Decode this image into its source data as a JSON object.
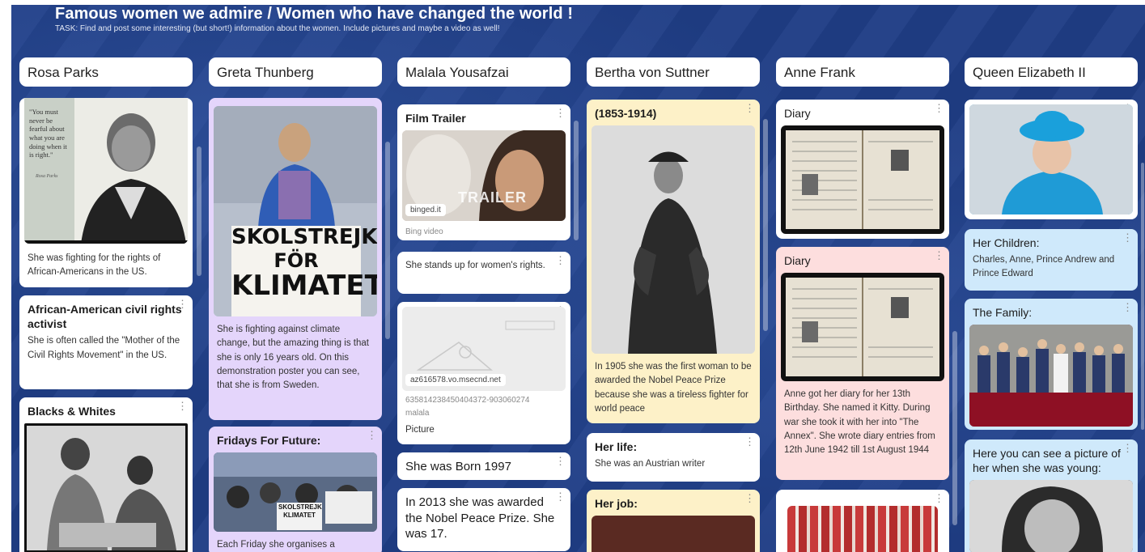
{
  "board": {
    "title": "Famous women we admire / Women who have changed the world !",
    "subtitle": "TASK: Find and post some interesting (but short!) information about the women. Include pictures and maybe a video as well!"
  },
  "columns": [
    {
      "header": "Rosa Parks",
      "posts": [
        {
          "body": "She was fighting for the rights of African-Americans in the US.",
          "quote": "\"You must never be fearful about what you are doing when it is right.\"",
          "quote_attr": "Rosa Parks"
        },
        {
          "title": "African-American civil rights activist",
          "body": "She is often called the \"Mother of the Civil Rights Movement\" in the US."
        },
        {
          "title": "Blacks & Whites"
        }
      ]
    },
    {
      "header": "Greta Thunberg",
      "posts": [
        {
          "sign_line1": "SKOLSTREJK",
          "sign_line2": "FÖR",
          "sign_line3": "KLIMATET",
          "body": "She is fighting against climate change, but the amazing thing is that she is only 16 years old. On this demonstration poster you can see, that she is from Sweden."
        },
        {
          "title": "Fridays For Future:",
          "sign_small1": "SKOLSTREJK",
          "sign_small2": "KLIMATET",
          "body": "Each Friday she organises a"
        }
      ]
    },
    {
      "header": "Malala Yousafzai",
      "posts": [
        {
          "title": "Film Trailer",
          "link": "binged.it",
          "overlay": "TRAILER",
          "meta": "Bing video"
        },
        {
          "body": "She stands up for women's rights."
        },
        {
          "link": "az616578.vo.msecnd.net",
          "meta1": "635814238450404372-903060274",
          "meta2": "malala",
          "label": "Picture"
        },
        {
          "title": "She was Born 1997"
        },
        {
          "title": "In 2013 she was awarded the Nobel Peace Prize. She was 17."
        }
      ]
    },
    {
      "header": "Bertha von Suttner",
      "posts": [
        {
          "title": "(1853-1914)",
          "body": "In 1905 she was the first woman to be awarded the Nobel Peace Prize because she was a tireless fighter for world peace"
        },
        {
          "title": "Her life:",
          "body": "She was an Austrian writer"
        },
        {
          "title": "Her job:"
        }
      ]
    },
    {
      "header": "Anne Frank",
      "posts": [
        {
          "title": "Diary"
        },
        {
          "title": "Diary",
          "body": "Anne got her diary for her 13th Birthday. She named it Kitty. During war she took it with her into \"The Annex\". She wrote diary entries from 12th June 1942 till 1st August 1944"
        },
        {
          "title": ""
        }
      ]
    },
    {
      "header": "Queen Elizabeth II",
      "posts": [
        {
          "title": ""
        },
        {
          "title": "Her Children:",
          "body": "Charles, Anne, Prince Andrew and Prince Edward"
        },
        {
          "title": "The Family:"
        },
        {
          "title": "Here you can see a picture of her when she was young:"
        }
      ]
    }
  ],
  "icons": {
    "post_menu": "⋮"
  },
  "colors": {
    "board_bg": "#1f3d85",
    "lilac": "#e4d5fb",
    "cream": "#fdf1c8",
    "pink": "#fddede",
    "blue": "#cfe9fb"
  }
}
